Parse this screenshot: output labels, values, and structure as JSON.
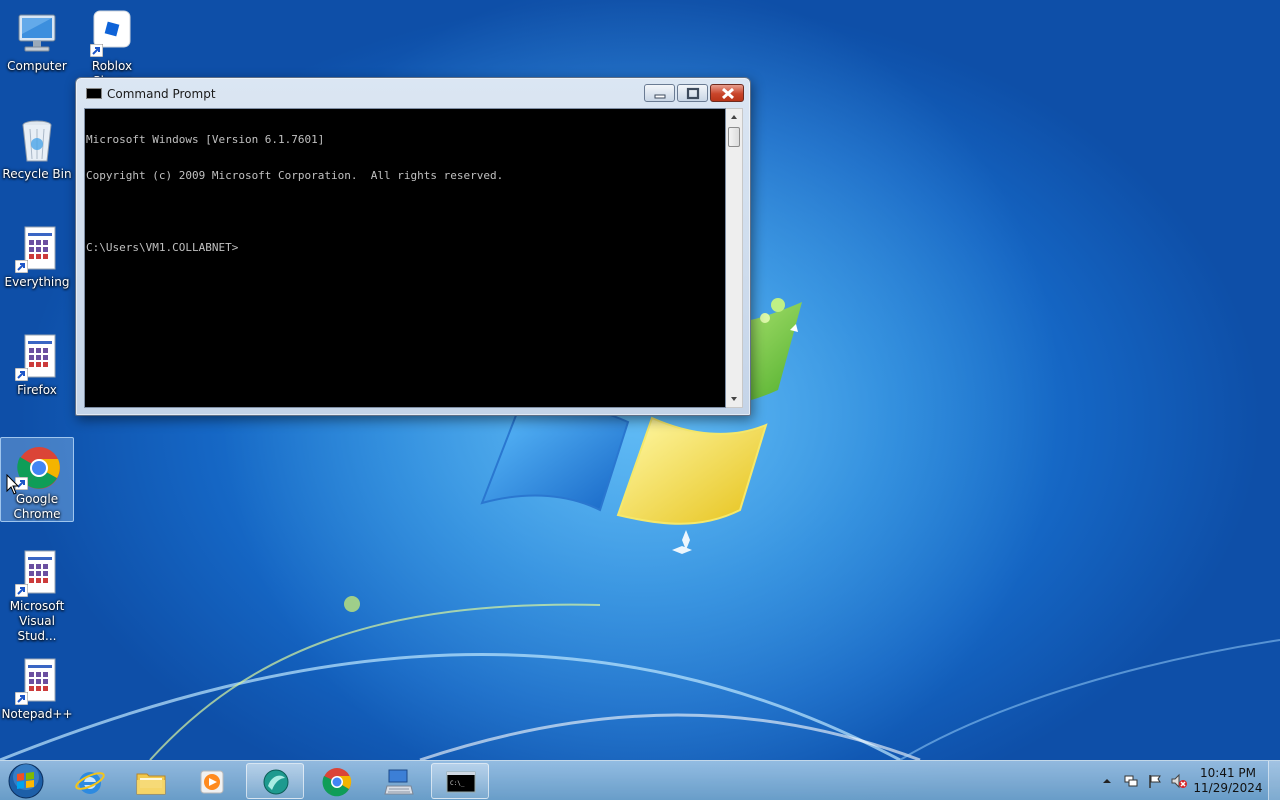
{
  "desktop": {
    "icons": [
      {
        "label": "Computer",
        "icon": "computer-icon"
      },
      {
        "label": "Roblox Player",
        "icon": "roblox-icon"
      },
      {
        "label": "Recycle Bin",
        "icon": "recycle-bin-icon"
      },
      {
        "label": "Everything",
        "icon": "generic-app-icon"
      },
      {
        "label": "Firefox",
        "icon": "generic-app-icon"
      },
      {
        "label": "Google Chrome",
        "icon": "chrome-icon",
        "selected": true
      },
      {
        "label": "Microsoft Visual Stud...",
        "icon": "generic-app-icon"
      },
      {
        "label": "Notepad++",
        "icon": "generic-app-icon"
      }
    ]
  },
  "cmd_window": {
    "title": "Command Prompt",
    "lines": [
      "Microsoft Windows [Version 6.1.7601]",
      "Copyright (c) 2009 Microsoft Corporation.  All rights reserved.",
      "",
      "C:\\Users\\VM1.COLLABNET>"
    ],
    "text_color": "#c0c0c0",
    "background_color": "#000000"
  },
  "taskbar": {
    "items": [
      {
        "name": "internet-explorer",
        "icon": "ie-icon",
        "open": false
      },
      {
        "name": "windows-explorer",
        "icon": "folder-icon",
        "open": false
      },
      {
        "name": "media-player",
        "icon": "media-player-icon",
        "open": false
      },
      {
        "name": "app-teal",
        "icon": "teal-app-icon",
        "open": true
      },
      {
        "name": "google-chrome",
        "icon": "chrome-icon",
        "open": false
      },
      {
        "name": "remote-desktop",
        "icon": "keyboard-icon",
        "open": false
      },
      {
        "name": "command-prompt",
        "icon": "cmd-icon",
        "open": true
      }
    ],
    "clock": {
      "time": "10:41 PM",
      "date": "11/29/2024"
    }
  },
  "colors": {
    "close_button": "#c9452a",
    "wallpaper_blue": "#1f7fd6"
  }
}
